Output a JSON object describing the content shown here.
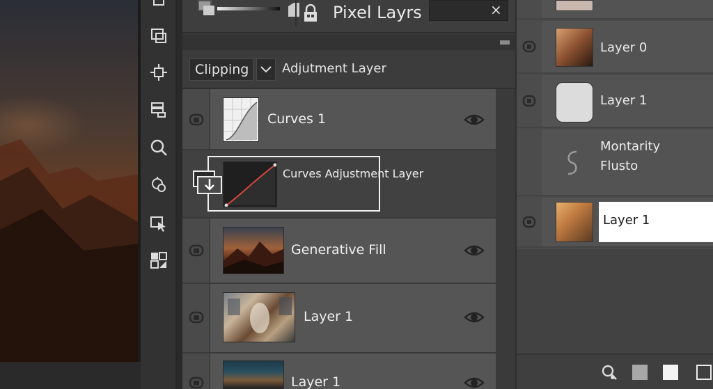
{
  "header": {
    "title": "Pixel Layrs",
    "close_glyph": "×"
  },
  "options": {
    "clipping_label": "Clipping",
    "adjustment_label": "Adjutment Layer"
  },
  "layers": [
    {
      "name": "Curves 1",
      "type": "curves",
      "visible": true
    },
    {
      "name": "Curves Adjustment Layer",
      "type": "adjustment-drag"
    },
    {
      "name": "Generative Fill",
      "type": "image-mountain",
      "visible": true
    },
    {
      "name": "Layer 1",
      "type": "image-collage",
      "visible": true
    },
    {
      "name": "Layer 1",
      "type": "image-figure",
      "visible": true
    }
  ],
  "right_layers": [
    {
      "name": "Layer 0"
    },
    {
      "name": "Layer 1"
    },
    {
      "name_line1": "Montarity",
      "name_line2": "Flusto"
    },
    {
      "name": "Layer 1",
      "selected": true
    }
  ],
  "icons": {
    "tools": [
      "transform-icon",
      "crop-frame-icon",
      "move-icon",
      "layers-stack-icon",
      "search-icon",
      "target-settings-icon",
      "select-arrow-icon",
      "pattern-icon"
    ],
    "footer": [
      "magnifier-icon",
      "gray-swatch-icon",
      "white-swatch-icon",
      "frame-icon"
    ]
  },
  "colors": {
    "panel_bg": "#3a3a3a",
    "row_bg": "#555555",
    "selected_bg": "#ffffff",
    "curve_red": "#d8463e"
  }
}
